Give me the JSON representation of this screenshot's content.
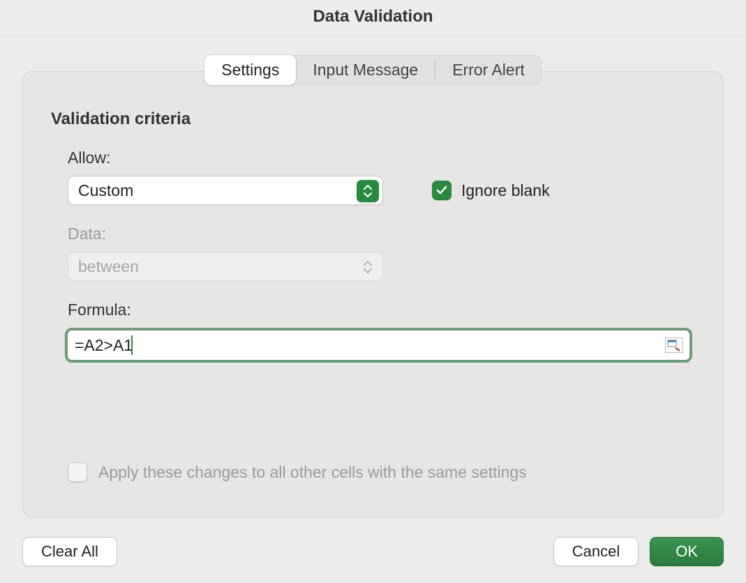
{
  "window": {
    "title": "Data Validation"
  },
  "tabs": {
    "settings": "Settings",
    "input_message": "Input Message",
    "error_alert": "Error Alert"
  },
  "section": {
    "heading": "Validation criteria",
    "allow_label": "Allow:",
    "allow_value": "Custom",
    "data_label": "Data:",
    "data_value": "between",
    "formula_label": "Formula:",
    "formula_value": "=A2>A1",
    "ignore_blank_label": "Ignore blank",
    "apply_all_label": "Apply these changes to all other cells with the same settings"
  },
  "buttons": {
    "clear_all": "Clear All",
    "cancel": "Cancel",
    "ok": "OK"
  }
}
